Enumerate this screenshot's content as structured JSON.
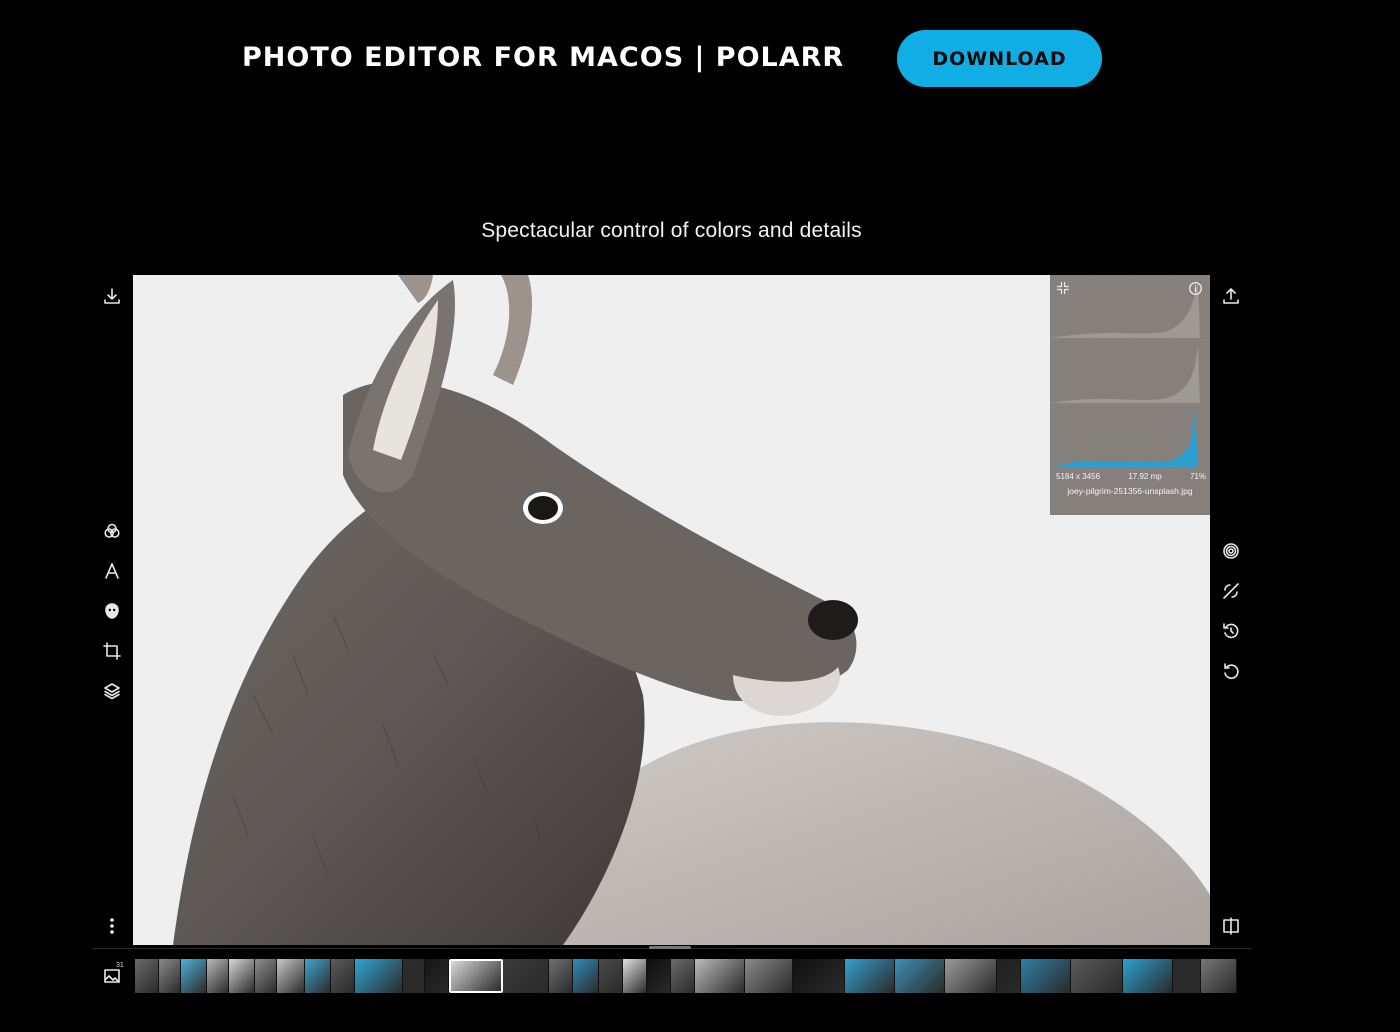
{
  "header": {
    "title": "PHOTO EDITOR FOR MACOS | POLARR",
    "download_label": "DOWNLOAD"
  },
  "subtitle": "Spectacular control of colors and details",
  "toolbar_left": {
    "top": [
      {
        "icon": "download-icon"
      }
    ],
    "middle": [
      {
        "icon": "filters-icon"
      },
      {
        "icon": "text-icon"
      },
      {
        "icon": "face-icon"
      },
      {
        "icon": "crop-icon"
      },
      {
        "icon": "layers-icon"
      }
    ],
    "bottom": [
      {
        "icon": "more-icon"
      }
    ]
  },
  "toolbar_right": {
    "top": [
      {
        "icon": "export-icon"
      }
    ],
    "middle": [
      {
        "icon": "adjust-icon"
      },
      {
        "icon": "compare-icon"
      },
      {
        "icon": "history-icon"
      },
      {
        "icon": "reset-icon"
      }
    ],
    "bottom": [
      {
        "icon": "split-view-icon"
      }
    ]
  },
  "histogram": {
    "dimensions": "5184 x 3456",
    "megapixels": "17.92 mp",
    "zoom": "71%",
    "filename": "joey-pilgrim-251356-unsplash.jpg",
    "accent_color": "#2b9fd0"
  },
  "filmstrip": {
    "gallery_count": "31",
    "thumbnails": [
      {
        "color": "#6a6a6a",
        "w": 24
      },
      {
        "color": "#8a8a8a",
        "w": 22
      },
      {
        "color": "#4db3d8",
        "w": 26
      },
      {
        "color": "#b9b9b9",
        "w": 22
      },
      {
        "color": "#d8d8d8",
        "w": 26
      },
      {
        "color": "#8f8f8f",
        "w": 22
      },
      {
        "color": "#c9c9c9",
        "w": 28
      },
      {
        "color": "#3ea5cc",
        "w": 26
      },
      {
        "color": "#5b5b5b",
        "w": 24
      },
      {
        "color": "#2fa6d5",
        "w": 48
      },
      {
        "color": "#2b2b2b",
        "w": 22
      },
      {
        "color": "#151515",
        "w": 24
      },
      {
        "color": "#d9d9d9",
        "w": 54,
        "selected": true
      },
      {
        "color": "#3a3a3a",
        "w": 46
      },
      {
        "color": "#707070",
        "w": 24
      },
      {
        "color": "#2e8fb8",
        "w": 26
      },
      {
        "color": "#4a4a4a",
        "w": 24
      },
      {
        "color": "#e2e2e2",
        "w": 24
      },
      {
        "color": "#0e0e0e",
        "w": 24
      },
      {
        "color": "#6c6c6c",
        "w": 24
      },
      {
        "color": "#bcbcbc",
        "w": 50
      },
      {
        "color": "#8a8a8a",
        "w": 48
      },
      {
        "color": "#101010",
        "w": 52
      },
      {
        "color": "#34a0cf",
        "w": 50
      },
      {
        "color": "#3d8fb6",
        "w": 50
      },
      {
        "color": "#9a9a9a",
        "w": 52
      },
      {
        "color": "#202020",
        "w": 24
      },
      {
        "color": "#2f7fa6",
        "w": 50
      },
      {
        "color": "#5a5a5a",
        "w": 52
      },
      {
        "color": "#2aa2d2",
        "w": 50
      },
      {
        "color": "#2a2a2a",
        "w": 28
      },
      {
        "color": "#777777",
        "w": 36
      }
    ]
  },
  "colors": {
    "background": "#000000",
    "accent": "#11aee6"
  }
}
